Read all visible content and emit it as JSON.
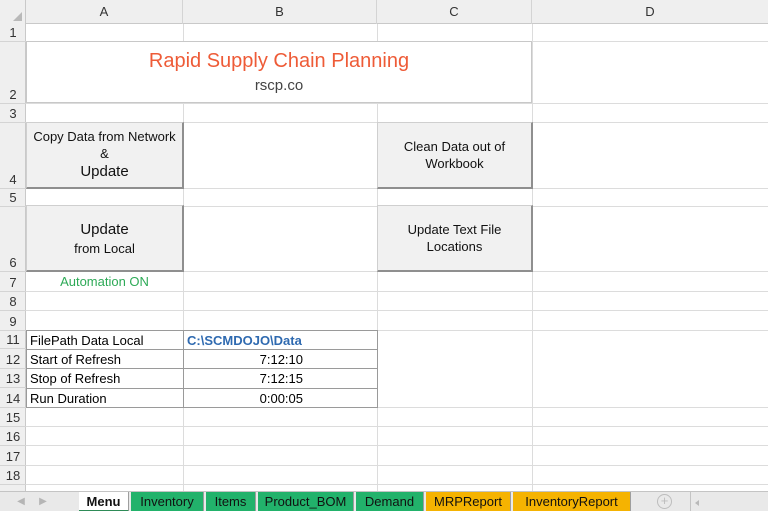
{
  "columns": [
    "A",
    "B",
    "C",
    "D"
  ],
  "rows": [
    "1",
    "2",
    "3",
    "4",
    "5",
    "6",
    "7",
    "8",
    "9",
    "11",
    "12",
    "13",
    "14",
    "15",
    "16",
    "17",
    "18"
  ],
  "title": {
    "heading": "Rapid Supply Chain Planning",
    "subheading": "rscp.co"
  },
  "buttons": {
    "copy_update": {
      "line1": "Copy Data from Network",
      "line2": "&",
      "line3": "Update"
    },
    "clean_data": {
      "line1": "Clean Data out of",
      "line2": "Workbook"
    },
    "update_local": {
      "line1": "Update",
      "line2": "from Local"
    },
    "update_text": {
      "line1": "Update Text File",
      "line2": "Locations"
    }
  },
  "automation_status": "Automation ON",
  "info_table": [
    {
      "label": "FilePath Data Local",
      "value": "C:\\SCMDOJO\\Data"
    },
    {
      "label": "Start of Refresh",
      "value": "7:12:10"
    },
    {
      "label": "Stop of Refresh",
      "value": "7:12:15"
    },
    {
      "label": "Run Duration",
      "value": "0:00:05"
    }
  ],
  "sheet_tabs": [
    {
      "label": "Menu",
      "color": "#ffffff",
      "active": true
    },
    {
      "label": "Inventory",
      "color": "#22b26b",
      "active": false
    },
    {
      "label": "Items",
      "color": "#22b26b",
      "active": false
    },
    {
      "label": "Product_BOM",
      "color": "#22b26b",
      "active": false
    },
    {
      "label": "Demand",
      "color": "#22b26b",
      "active": false
    },
    {
      "label": "MRPReport",
      "color": "#f5b301",
      "active": false
    },
    {
      "label": "InventoryReport",
      "color": "#f5b301",
      "active": false
    }
  ],
  "icons": {
    "prev_sheet": "chevron-left-icon",
    "next_sheet": "chevron-right-icon",
    "add_sheet": "plus-circle-icon"
  },
  "colors": {
    "title": "#ee5b37",
    "automation": "#2eaa57",
    "path": "#2f6ab0"
  }
}
